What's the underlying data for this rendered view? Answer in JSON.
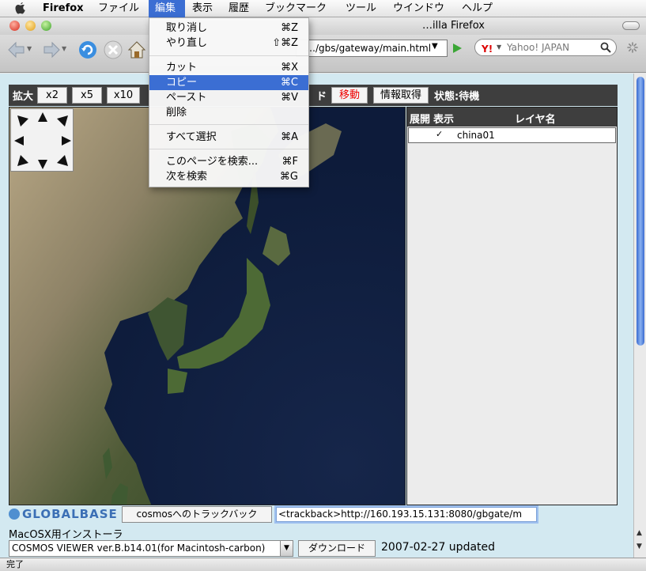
{
  "menubar": {
    "app": "Firefox",
    "items": [
      "ファイル",
      "編集",
      "表示",
      "履歴",
      "ブックマーク",
      "ツール",
      "ウインドウ",
      "ヘルプ"
    ]
  },
  "window": {
    "title": "…illa Firefox"
  },
  "toolbar": {
    "url": "…/gbs/gateway/main.html",
    "search_placeholder": "Yahoo! JAPAN",
    "search_logo": "Y!"
  },
  "edit_menu": {
    "items": [
      {
        "label": "取り消し",
        "shortcut": "⌘Z"
      },
      {
        "label": "やり直し",
        "shortcut": "⇧⌘Z"
      },
      {
        "label": "カット",
        "shortcut": "⌘X"
      },
      {
        "label": "コピー",
        "shortcut": "⌘C"
      },
      {
        "label": "ペースト",
        "shortcut": "⌘V"
      },
      {
        "label": "削除",
        "shortcut": ""
      },
      {
        "label": "すべて選択",
        "shortcut": "⌘A"
      },
      {
        "label": "このページを検索...",
        "shortcut": "⌘F"
      },
      {
        "label": "次を検索",
        "shortcut": "⌘G"
      }
    ],
    "highlighted": "コピー"
  },
  "tool_strip": {
    "zoom_label": "拡大",
    "zoom_buttons": [
      "x2",
      "x5",
      "x10"
    ],
    "mode_suffix": "ド",
    "move_button": "移動",
    "info_button": "情報取得",
    "status": "状態:待機"
  },
  "layer_panel": {
    "columns": [
      "展開",
      "表示",
      "レイヤ名"
    ],
    "rows": [
      {
        "name": "china01",
        "checked": true
      }
    ]
  },
  "footer": {
    "logo": "GLOBALBASE",
    "trackback_button": "cosmosへのトラックバック",
    "trackback_url": "<trackback>http://160.193.15.131:8080/gbgate/m",
    "installer_label": "MacOSX用インストーラ",
    "viewer_option": "COSMOS VIEWER ver.B.b14.01(for Macintosh-carbon)",
    "download_button": "ダウンロード",
    "updated": "2007-02-27 updated"
  },
  "statusbar": {
    "text": "完了"
  },
  "colors": {
    "highlight": "#3b6ed3",
    "strip": "#3e3e3e",
    "move_text": "#e00000"
  }
}
